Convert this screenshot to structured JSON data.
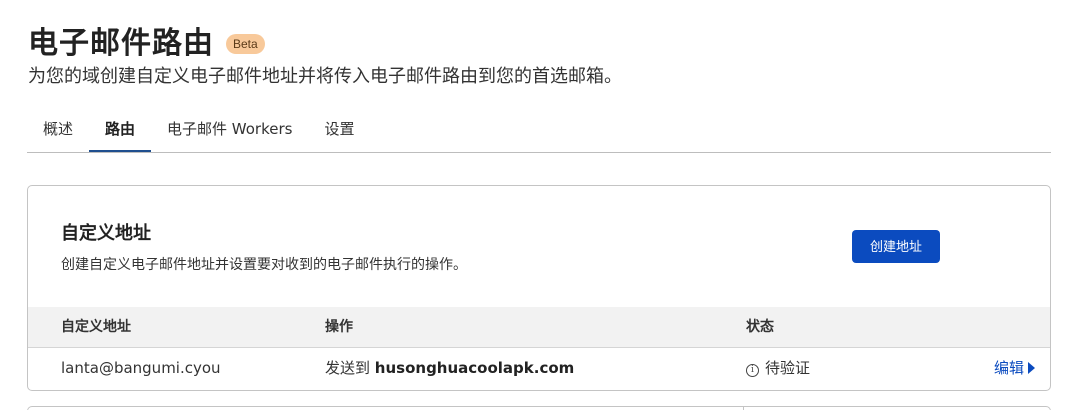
{
  "header": {
    "title": "电子邮件路由",
    "badge": "Beta",
    "subtitle": "为您的域创建自定义电子邮件地址并将传入电子邮件路由到您的首选邮箱。"
  },
  "tabs": [
    {
      "label": "概述",
      "active": false
    },
    {
      "label": "路由",
      "active": true
    },
    {
      "label": "电子邮件 Workers",
      "active": false
    },
    {
      "label": "设置",
      "active": false
    }
  ],
  "custom_addresses": {
    "title": "自定义地址",
    "description": "创建自定义电子邮件地址并设置要对收到的电子邮件执行的操作。",
    "create_button": "创建地址",
    "columns": {
      "address": "自定义地址",
      "action": "操作",
      "status": "状态"
    },
    "rows": [
      {
        "address": "lanta@bangumi.cyou",
        "action_prefix": "发送到",
        "action_target": "husonghuacoolapk.com",
        "status": "待验证",
        "edit_label": "编辑"
      }
    ]
  },
  "colors": {
    "accent": "#0b4bbf",
    "badge_bg": "#f8c99a",
    "tab_underline": "#1f4f8f"
  }
}
